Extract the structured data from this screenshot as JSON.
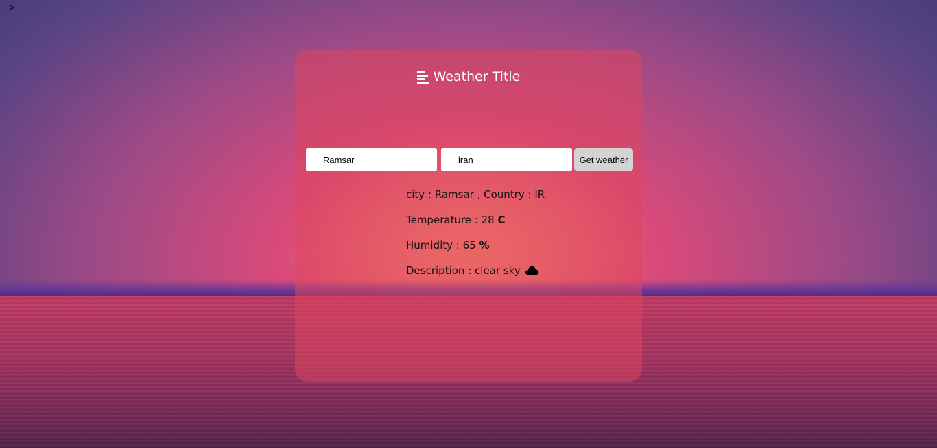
{
  "stray_text": "-->",
  "header": {
    "title": "Weather Title",
    "icon": "menu-lines-icon"
  },
  "form": {
    "city_value": "Ramsar",
    "country_value": "iran",
    "submit_label": "Get weather"
  },
  "results": {
    "city_label": "city : ",
    "city_value": "Ramsar",
    "country_label": " , Country : ",
    "country_value": "IR",
    "temperature_label": "Temperature : ",
    "temperature_value": "28",
    "temperature_unit": "C",
    "humidity_label": "Humidity : ",
    "humidity_value": "65",
    "humidity_unit": "%",
    "description_label": "Description : ",
    "description_value": "clear sky",
    "description_icon": "cloud-icon"
  },
  "colors": {
    "card": "#dc465f",
    "button": "#d3d3d3",
    "text_dark": "#111111",
    "text_light": "#ffffff"
  }
}
